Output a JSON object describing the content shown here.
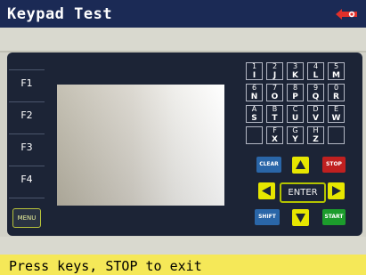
{
  "window": {
    "title": "Keypad Test",
    "brand_color": "#1b2a55"
  },
  "function_keys": [
    {
      "label": "F1"
    },
    {
      "label": "F2"
    },
    {
      "label": "F3"
    },
    {
      "label": "F4"
    }
  ],
  "menu_button": {
    "label": "MENU"
  },
  "keypad": [
    {
      "num": "1",
      "letter": "I"
    },
    {
      "num": "2",
      "letter": "J"
    },
    {
      "num": "3",
      "letter": "K"
    },
    {
      "num": "4",
      "letter": "L"
    },
    {
      "num": "5",
      "letter": "M"
    },
    {
      "num": "6",
      "letter": "N"
    },
    {
      "num": "7",
      "letter": "O"
    },
    {
      "num": "8",
      "letter": "P"
    },
    {
      "num": "9",
      "letter": "Q"
    },
    {
      "num": "0",
      "letter": "R"
    },
    {
      "num": "A",
      "letter": "S"
    },
    {
      "num": "B",
      "letter": "T"
    },
    {
      "num": "C",
      "letter": "U"
    },
    {
      "num": "D",
      "letter": "V"
    },
    {
      "num": "E",
      "letter": "W"
    },
    {
      "num": "",
      "letter": ""
    },
    {
      "num": "F",
      "letter": "X"
    },
    {
      "num": "G",
      "letter": "Y"
    },
    {
      "num": "H",
      "letter": "Z"
    },
    {
      "num": "",
      "letter": ""
    }
  ],
  "controls": {
    "clear_label": "CLEAR",
    "stop_label": "STOP",
    "enter_label": "ENTER",
    "shift_label": "SHIFT",
    "start_label": "START",
    "clear_color": "#2a66a8",
    "stop_color": "#c02020",
    "start_color": "#1c9c2c",
    "arrow_color": "#e6e600"
  },
  "status": {
    "message": "Press keys, STOP to exit",
    "bg_color": "#f5e858"
  }
}
